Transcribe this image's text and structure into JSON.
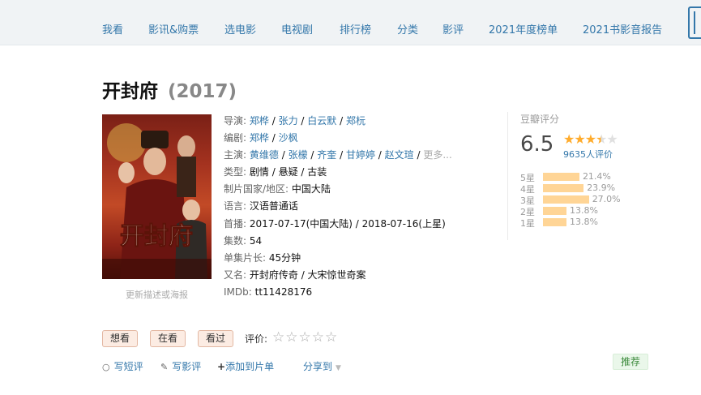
{
  "nav": {
    "items": [
      "我看",
      "影讯&购票",
      "选电影",
      "电视剧",
      "排行榜",
      "分类",
      "影评",
      "2021年度榜单",
      "2021书影音报告"
    ]
  },
  "title": {
    "name": "开封府",
    "year": "(2017)"
  },
  "poster": {
    "caption_text": "开封府",
    "link": "更新描述或海报"
  },
  "info": {
    "director_label": "导演",
    "directors": [
      "郑桦",
      "张力",
      "白云默",
      "郑杬"
    ],
    "writer_label": "编剧",
    "writers": [
      "郑桦",
      "沙枫"
    ],
    "cast_label": "主演",
    "cast": [
      "黄维德",
      "张檬",
      "齐奎",
      "甘婷婷",
      "赵文瑄"
    ],
    "more": "更多...",
    "genre_label": "类型:",
    "genres": [
      "剧情",
      "悬疑",
      "古装"
    ],
    "country_label": "制片国家/地区:",
    "country": "中国大陆",
    "language_label": "语言:",
    "language": "汉语普通话",
    "premiere_label": "首播:",
    "premiere": "2017-07-17(中国大陆) / 2018-07-16(上星)",
    "episodes_label": "集数:",
    "episodes": "54",
    "runtime_label": "单集片长:",
    "runtime": "45分钟",
    "aka_label": "又名:",
    "aka": "开封府传奇 / 大宋惊世奇案",
    "imdb_label": "IMDb:",
    "imdb": "tt11428176"
  },
  "rating": {
    "label": "豆瓣评分",
    "score": "6.5",
    "stars_filled": 3.5,
    "stars_total": 5,
    "count": "9635人评价",
    "distribution": [
      {
        "label": "5星",
        "percent": 21.4,
        "text": "21.4%"
      },
      {
        "label": "4星",
        "percent": 23.9,
        "text": "23.9%"
      },
      {
        "label": "3星",
        "percent": 27.0,
        "text": "27.0%"
      },
      {
        "label": "2星",
        "percent": 13.8,
        "text": "13.8%"
      },
      {
        "label": "1星",
        "percent": 13.8,
        "text": "13.8%"
      }
    ]
  },
  "actions": {
    "want": "想看",
    "watching": "在看",
    "watched": "看过",
    "rate_label": "评价:",
    "rate_stars": "☆☆☆☆☆"
  },
  "links": {
    "short_review": "写短评",
    "review": "写影评",
    "add_list": "添加到片单",
    "share": "分享到",
    "recommend": "推荐"
  },
  "colors": {
    "link": "#3377aa",
    "star": "#ffac2d",
    "bar": "#ffd596",
    "button_bg": "#fcece3"
  }
}
